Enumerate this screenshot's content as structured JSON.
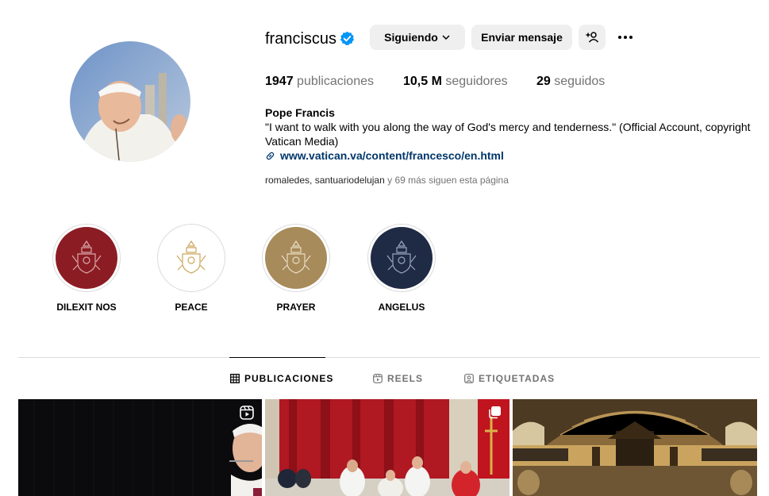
{
  "profile": {
    "username": "franciscus",
    "full_name": "Pope Francis",
    "bio": "\"I want to walk with you along the way of God's mercy and tenderness.\" (Official Account, copyright Vatican Media)",
    "link": "www.vatican.va/content/francesco/en.html",
    "followed_by_1": "romaledes",
    "followed_by_2": "santuariodelujan",
    "followed_by_rest": "y 69 más siguen esta página",
    "followed_by_sep": ", "
  },
  "buttons": {
    "following": "Siguiendo",
    "message": "Enviar mensaje"
  },
  "stats": {
    "posts_count": "1947",
    "posts_label": "publicaciones",
    "followers_count": "10,5 M",
    "followers_label": "seguidores",
    "following_count": "29",
    "following_label": "seguidos"
  },
  "highlights": [
    {
      "label": "DILEXIT NOS",
      "color": "#8c1c24"
    },
    {
      "label": "PEACE",
      "color": "#ffffff"
    },
    {
      "label": "PRAYER",
      "color": "#a88b5a"
    },
    {
      "label": "ANGELUS",
      "color": "#1f2a44"
    }
  ],
  "tabs": [
    {
      "label": "PUBLICACIONES",
      "icon": "grid-icon",
      "active": true
    },
    {
      "label": "REELS",
      "icon": "reels-icon",
      "active": false
    },
    {
      "label": "ETIQUETADAS",
      "icon": "tagged-icon",
      "active": false
    }
  ],
  "colors": {
    "verified": "#0095f6",
    "link": "#00376b",
    "button_bg": "#efefef",
    "muted": "#737373"
  }
}
